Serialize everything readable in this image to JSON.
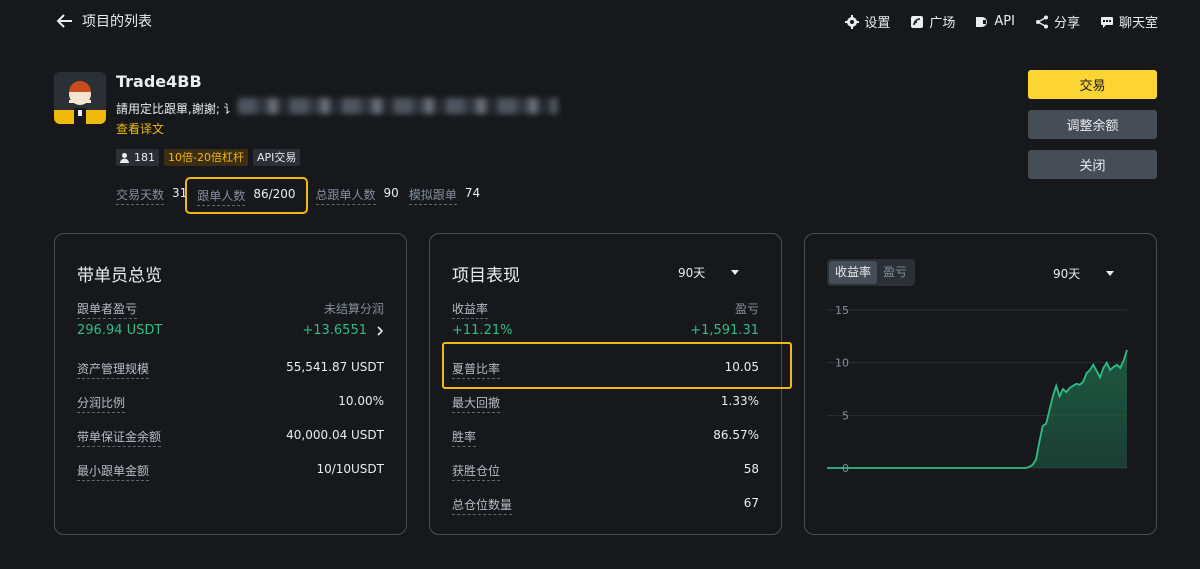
{
  "topbar": {
    "back_label": "项目的列表",
    "nav": [
      {
        "icon": "gear-icon",
        "label": "设置"
      },
      {
        "icon": "square-icon",
        "label": "广场"
      },
      {
        "icon": "api-icon",
        "label": "API"
      },
      {
        "icon": "share-icon",
        "label": "分享"
      },
      {
        "icon": "chat-icon",
        "label": "聊天室"
      }
    ]
  },
  "profile": {
    "name": "Trade4BB",
    "description": "請用定比跟單,謝謝; 讠",
    "translate": "查看译文",
    "tags": {
      "followers": "181",
      "leverage": "10倍-20倍杠杆",
      "api": "API交易"
    },
    "stats": {
      "trade_days_label": "交易天数",
      "trade_days": "31",
      "copiers_label": "跟单人数",
      "copiers": "86/200",
      "total_copiers_label": "总跟单人数",
      "total_copiers": "90",
      "mock_label": "模拟跟单",
      "mock": "74"
    }
  },
  "actions": {
    "trade": "交易",
    "adjust": "调整余额",
    "close": "关闭"
  },
  "overview": {
    "title": "带单员总览",
    "pnl_label": "跟单者盈亏",
    "pnl_value": "296.94 USDT",
    "unsettled_label": "未结算分润",
    "unsettled_value": "+13.6551",
    "rows": [
      {
        "label": "资产管理规模",
        "value": "55,541.87 USDT"
      },
      {
        "label": "分润比例",
        "value": "10.00%"
      },
      {
        "label": "带单保证金余额",
        "value": "40,000.04 USDT"
      },
      {
        "label": "最小跟单金额",
        "value": "10/10USDT"
      }
    ]
  },
  "performance": {
    "title": "项目表现",
    "period": "90天",
    "roi_label": "收益率",
    "roi_value": "+11.21%",
    "pnl_label": "盈亏",
    "pnl_value": "+1,591.31",
    "rows": [
      {
        "label": "夏普比率",
        "value": "10.05"
      },
      {
        "label": "最大回撤",
        "value": "1.33%"
      },
      {
        "label": "胜率",
        "value": "86.57%"
      },
      {
        "label": "获胜仓位",
        "value": "58"
      },
      {
        "label": "总仓位数量",
        "value": "67"
      }
    ]
  },
  "chart_panel": {
    "tab_roi": "收益率",
    "tab_pnl": "盈亏",
    "period": "90天",
    "colors": {
      "line": "#2ebd85",
      "fill": "#1e5c45"
    }
  },
  "chart_data": {
    "type": "area",
    "title": "",
    "xlabel": "",
    "ylabel": "",
    "ylim": [
      0,
      15
    ],
    "yticks": [
      "0",
      "5",
      "10",
      "15"
    ],
    "x": [
      1,
      2,
      3,
      4,
      5,
      6,
      7,
      8,
      9,
      10,
      11,
      12,
      13,
      14,
      15,
      16,
      17,
      18,
      19,
      20,
      21,
      22,
      23,
      24,
      25,
      26,
      27,
      28,
      29,
      30,
      31,
      32,
      33,
      34,
      35,
      36,
      37,
      38,
      39,
      40,
      41,
      42,
      43,
      44,
      45,
      46,
      47,
      48,
      49,
      50,
      51,
      52,
      53,
      54,
      55,
      56,
      57,
      58,
      59,
      60,
      61,
      62,
      63,
      64,
      65,
      66,
      67,
      68,
      69,
      70,
      71,
      72,
      73,
      74,
      75,
      76,
      77,
      78,
      79,
      80,
      81,
      82,
      83,
      84,
      85,
      86,
      87,
      88,
      89,
      90
    ],
    "values": [
      0,
      0,
      0,
      0,
      0,
      0,
      0,
      0,
      0,
      0,
      0,
      0,
      0,
      0,
      0,
      0,
      0,
      0,
      0,
      0,
      0,
      0,
      0,
      0,
      0,
      0,
      0,
      0,
      0,
      0,
      0,
      0,
      0,
      0,
      0,
      0,
      0,
      0,
      0,
      0,
      0,
      0,
      0,
      0,
      0,
      0,
      0,
      0,
      0,
      0,
      0,
      0,
      0,
      0,
      0,
      0,
      0,
      0,
      0,
      0,
      0.1,
      0.3,
      0.8,
      2.5,
      4.0,
      4.2,
      5.5,
      6.8,
      7.8,
      6.8,
      7.5,
      7.2,
      7.6,
      7.8,
      8.0,
      7.9,
      8.2,
      9.0,
      9.3,
      9.8,
      9.2,
      8.6,
      9.5,
      10.0,
      9.3,
      9.6,
      9.8,
      9.5,
      10.2,
      11.2
    ]
  }
}
